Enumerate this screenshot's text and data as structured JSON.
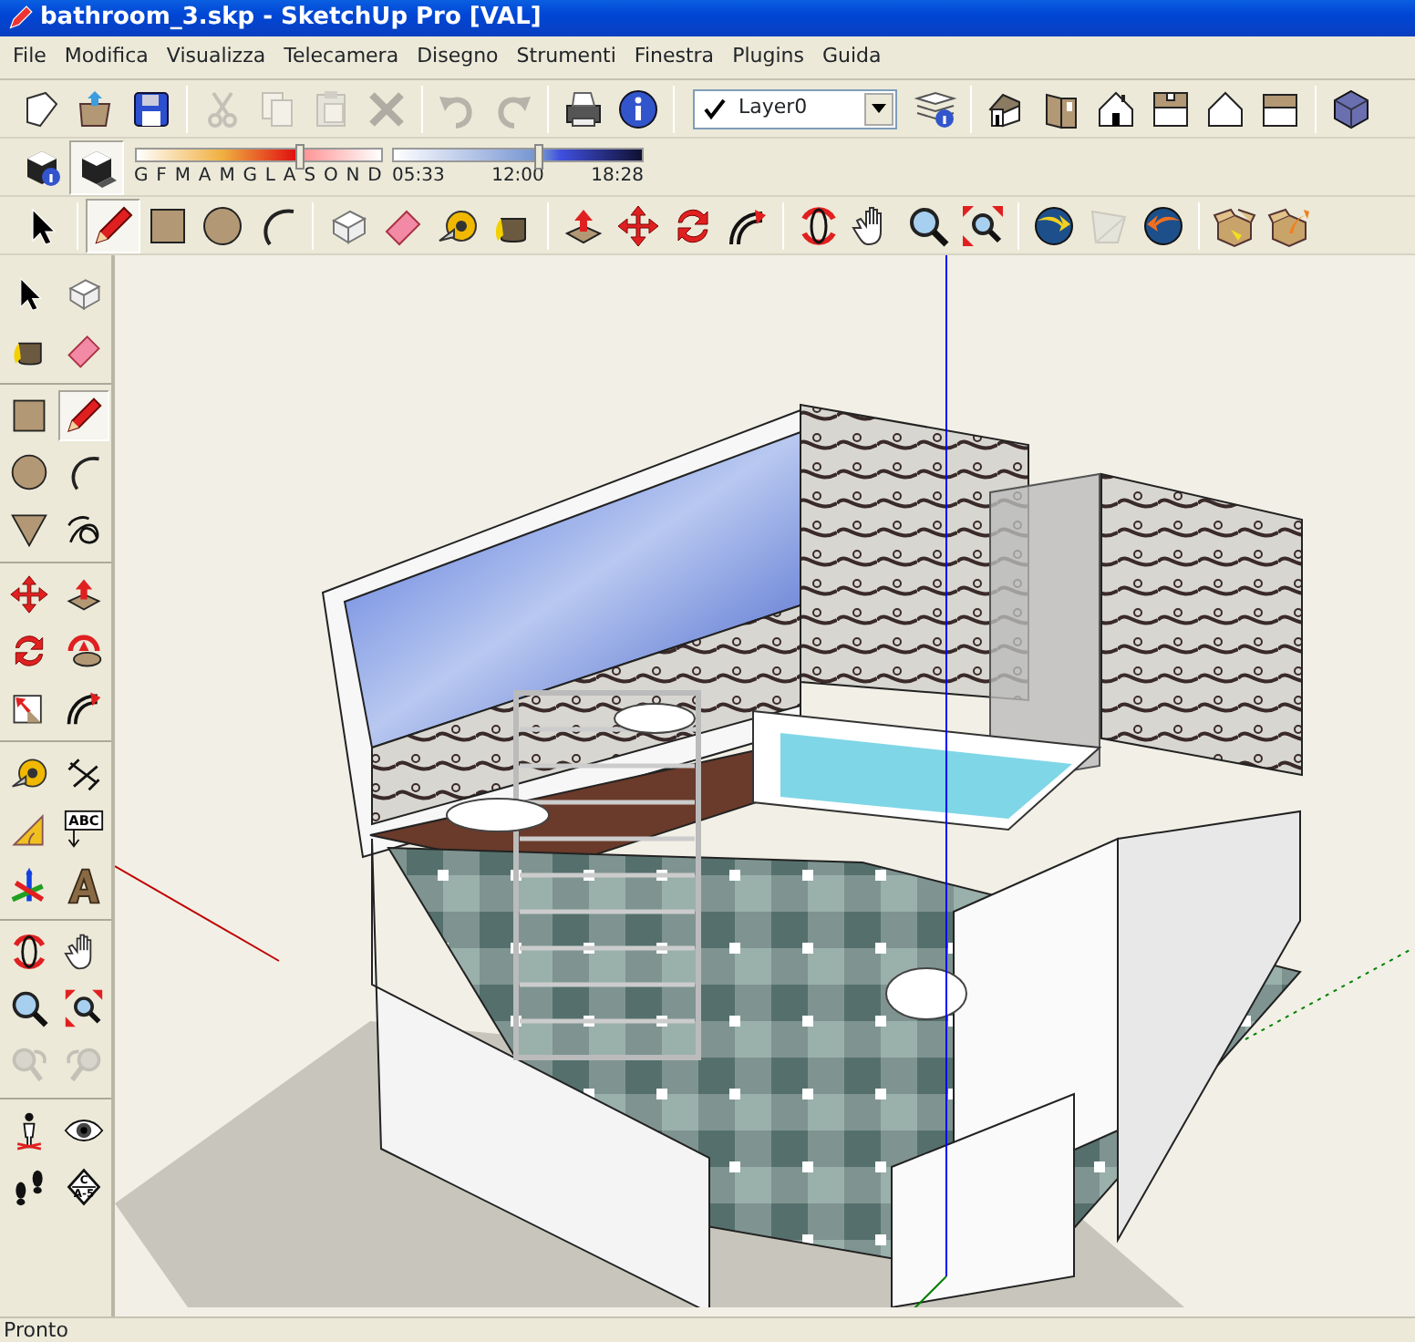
{
  "window": {
    "title": "bathroom_3.skp - SketchUp Pro [VAL]"
  },
  "menu": [
    "File",
    "Modifica",
    "Visualizza",
    "Telecamera",
    "Disegno",
    "Strumenti",
    "Finestra",
    "Plugins",
    "Guida"
  ],
  "standard_toolbar": [
    {
      "disabled": false
    },
    {
      "disabled": false
    },
    {
      "disabled": false
    },
    {
      "disabled": true
    },
    {
      "disabled": true
    },
    {
      "disabled": true
    },
    {
      "disabled": true
    },
    {
      "disabled": true
    },
    {
      "disabled": true
    },
    {
      "disabled": false
    },
    {
      "disabled": false
    }
  ],
  "layer_select": {
    "value": "Layer0",
    "current": true
  },
  "shadow_buttons": [
    {
      "selected": false
    },
    {
      "selected": true
    }
  ],
  "date_slider": {
    "labels": [
      "G",
      "F",
      "M",
      "A",
      "M",
      "G",
      "L",
      "A",
      "S",
      "O",
      "N",
      "D"
    ],
    "level": 0.67
  },
  "time_slider": {
    "labels": [
      "05:33",
      "12:00",
      "18:28"
    ],
    "level": 0.58
  },
  "draw_toolbar": [
    {
      "selected": false,
      "disabled": false
    },
    {
      "selected": true,
      "disabled": false
    },
    {
      "selected": false,
      "disabled": false
    },
    {
      "selected": false,
      "disabled": false
    },
    {
      "selected": false,
      "disabled": false
    },
    {
      "selected": false,
      "disabled": false
    },
    {
      "selected": false,
      "disabled": false
    },
    {
      "selected": false,
      "disabled": false
    },
    {
      "selected": false,
      "disabled": false
    },
    {
      "selected": false,
      "disabled": false
    },
    {
      "selected": false,
      "disabled": false
    },
    {
      "selected": false,
      "disabled": false
    },
    {
      "selected": false,
      "disabled": false
    },
    {
      "selected": false,
      "disabled": false
    },
    {
      "selected": false,
      "disabled": false
    },
    {
      "selected": false,
      "disabled": false
    },
    {
      "selected": false,
      "disabled": false
    },
    {
      "selected": false,
      "disabled": false
    },
    {
      "selected": false,
      "disabled": true
    },
    {
      "selected": false,
      "disabled": false
    },
    {
      "selected": false,
      "disabled": false
    },
    {
      "selected": false,
      "disabled": false
    }
  ],
  "side_toolbar": [
    {
      "selected": false,
      "disabled": false
    },
    {
      "selected": false,
      "disabled": false
    },
    {
      "selected": false,
      "disabled": false
    },
    {
      "selected": false,
      "disabled": false
    },
    {
      "selected": false,
      "disabled": false
    },
    {
      "selected": true,
      "disabled": false
    },
    {
      "selected": false,
      "disabled": false
    },
    {
      "selected": false,
      "disabled": false
    },
    {
      "selected": false,
      "disabled": false
    },
    {
      "selected": false,
      "disabled": false
    },
    {
      "selected": false,
      "disabled": false
    },
    {
      "selected": false,
      "disabled": false
    },
    {
      "selected": false,
      "disabled": false
    },
    {
      "selected": false,
      "disabled": false
    },
    {
      "selected": false,
      "disabled": false
    },
    {
      "selected": false,
      "disabled": false
    },
    {
      "selected": false,
      "disabled": false
    },
    {
      "selected": false,
      "disabled": false
    },
    {
      "selected": false,
      "disabled": false
    },
    {
      "selected": false,
      "disabled": false,
      "labels": [
        "ABC"
      ]
    },
    {
      "selected": false,
      "disabled": false
    },
    {
      "selected": false,
      "disabled": false
    },
    {
      "selected": false,
      "disabled": false
    },
    {
      "selected": false,
      "disabled": false
    },
    {
      "selected": false,
      "disabled": false
    },
    {
      "selected": false,
      "disabled": false
    },
    {
      "selected": false,
      "disabled": true
    },
    {
      "selected": false,
      "disabled": true
    },
    {
      "selected": false,
      "disabled": false
    },
    {
      "selected": false,
      "disabled": false
    },
    {
      "selected": false,
      "disabled": false
    },
    {
      "selected": false,
      "disabled": false,
      "labels": [
        "C",
        "A-5"
      ]
    }
  ],
  "status_bar": {
    "text": "Pronto"
  }
}
